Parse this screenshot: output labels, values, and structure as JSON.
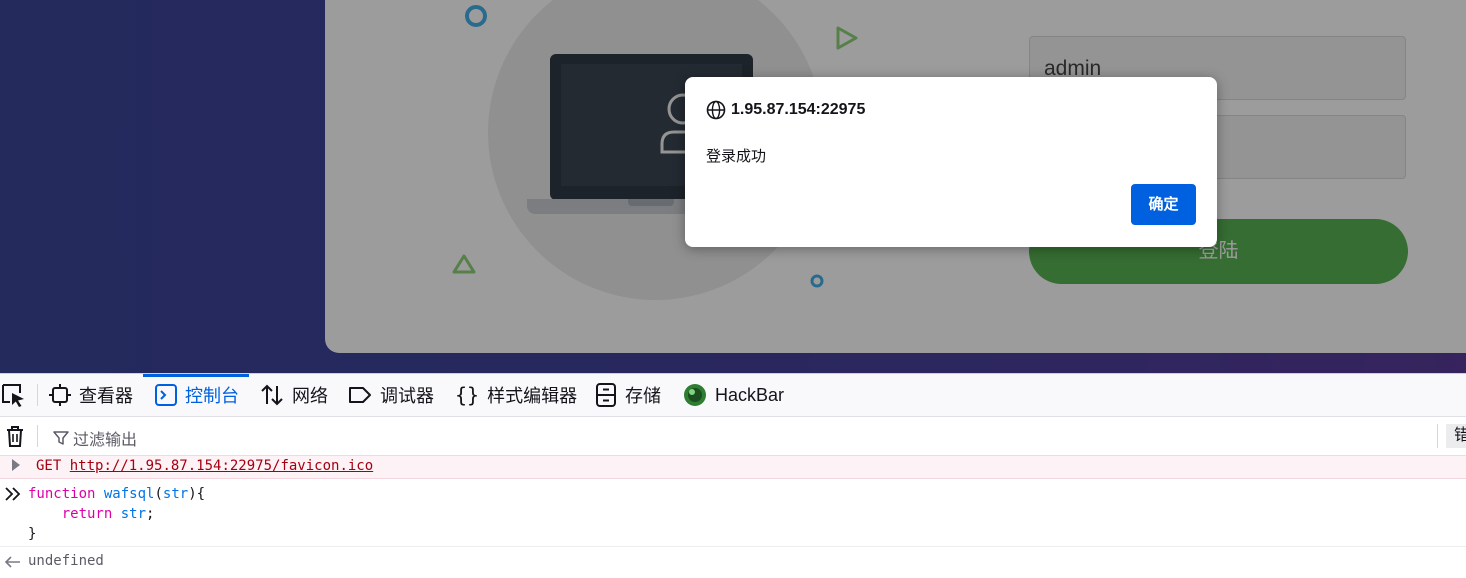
{
  "page": {
    "username_value": "admin",
    "password_value": "",
    "login_button_label": "登陆"
  },
  "alert": {
    "origin": "1.95.87.154:22975",
    "message": "登录成功",
    "ok_label": "确定"
  },
  "devtools": {
    "tabs": [
      {
        "label": "查看器",
        "icon": "inspector-icon"
      },
      {
        "label": "控制台",
        "icon": "console-icon",
        "active": true
      },
      {
        "label": "网络",
        "icon": "network-icon"
      },
      {
        "label": "调试器",
        "icon": "debugger-icon"
      },
      {
        "label": "样式编辑器",
        "icon": "style-editor-icon"
      },
      {
        "label": "存储",
        "icon": "storage-icon"
      },
      {
        "label": "HackBar",
        "icon": "hackbar-icon"
      }
    ],
    "filter_placeholder": "过滤输出",
    "errors_label_partial": "错",
    "accent_color": "#0061e0"
  },
  "console": {
    "error_method": "GET",
    "error_url": "http://1.95.87.154:22975/favicon.ico",
    "input_lines": [
      "function wafsql(str){",
      "    return str;",
      "}"
    ],
    "code_tokens": {
      "keyword_function": "function",
      "fn_name": "wafsql",
      "param": "str",
      "keyword_return": "return"
    },
    "result": "undefined"
  }
}
